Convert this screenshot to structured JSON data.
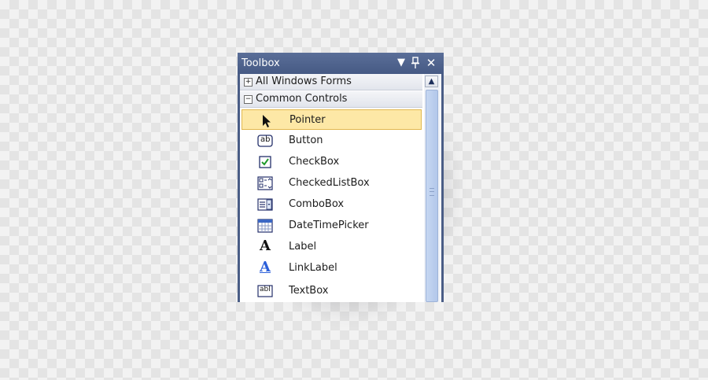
{
  "window": {
    "title": "Toolbox",
    "dropdown_glyph": "▼",
    "pin_glyph": "⊣",
    "close_glyph": "✕"
  },
  "groups": [
    {
      "label": "All Windows Forms",
      "expander": "+"
    },
    {
      "label": "Common Controls",
      "expander": "−"
    }
  ],
  "items": [
    {
      "label": "Pointer",
      "icon": "pointer-icon"
    },
    {
      "label": "Button",
      "icon": "button-icon"
    },
    {
      "label": "CheckBox",
      "icon": "checkbox-icon"
    },
    {
      "label": "CheckedListBox",
      "icon": "checkedlistbox-icon"
    },
    {
      "label": "ComboBox",
      "icon": "combobox-icon"
    },
    {
      "label": "DateTimePicker",
      "icon": "datetimepicker-icon"
    },
    {
      "label": "Label",
      "icon": "label-icon"
    },
    {
      "label": "LinkLabel",
      "icon": "linklabel-icon"
    },
    {
      "label": "TextBox",
      "icon": "textbox-icon"
    }
  ],
  "selected_item": "Pointer",
  "icon_text": {
    "button": "ab",
    "label": "A",
    "linklabel": "A",
    "textbox": "abl"
  },
  "colors": {
    "title_bar": "#4a5d86",
    "selection_fill": "#fde8a6",
    "selection_border": "#e2b84e",
    "link_blue": "#2b5fd9"
  }
}
